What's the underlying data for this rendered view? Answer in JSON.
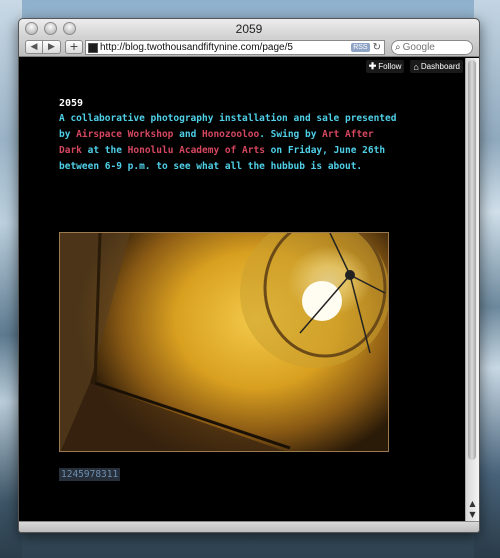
{
  "window": {
    "title": "2059"
  },
  "toolbar": {
    "back": "◀",
    "forward": "▶",
    "add": "+",
    "url": "http://blog.twothousandfiftynine.com/page/5",
    "rss": "RSS",
    "reload": "↻",
    "search_placeholder": "Google"
  },
  "tumblr_controls": {
    "follow_icon": "plus-icon",
    "follow": "Follow",
    "dashboard_icon": "house-icon",
    "dashboard": "Dashboard"
  },
  "post": {
    "title": "2059",
    "text_1": "A collaborative photography installation and sale presented by ",
    "link_airspace": "Airspace Workshop",
    "text_2": " and ",
    "link_honozooloo": "Honozooloo",
    "text_3": ". Swing by ",
    "link_aad": "Art After Dark",
    "text_4": " at the ",
    "link_hoa": "Honolulu Academy of Arts",
    "text_5": " on Friday, June 26th between 6-9 p.m. to see what all the hubbub is about.",
    "photo_alt": "Lamp shade with glowing bulb",
    "tag": "1245978311"
  },
  "colors": {
    "accent_text": "#4fd0e8",
    "link": "#d5475f",
    "background": "#000000"
  }
}
